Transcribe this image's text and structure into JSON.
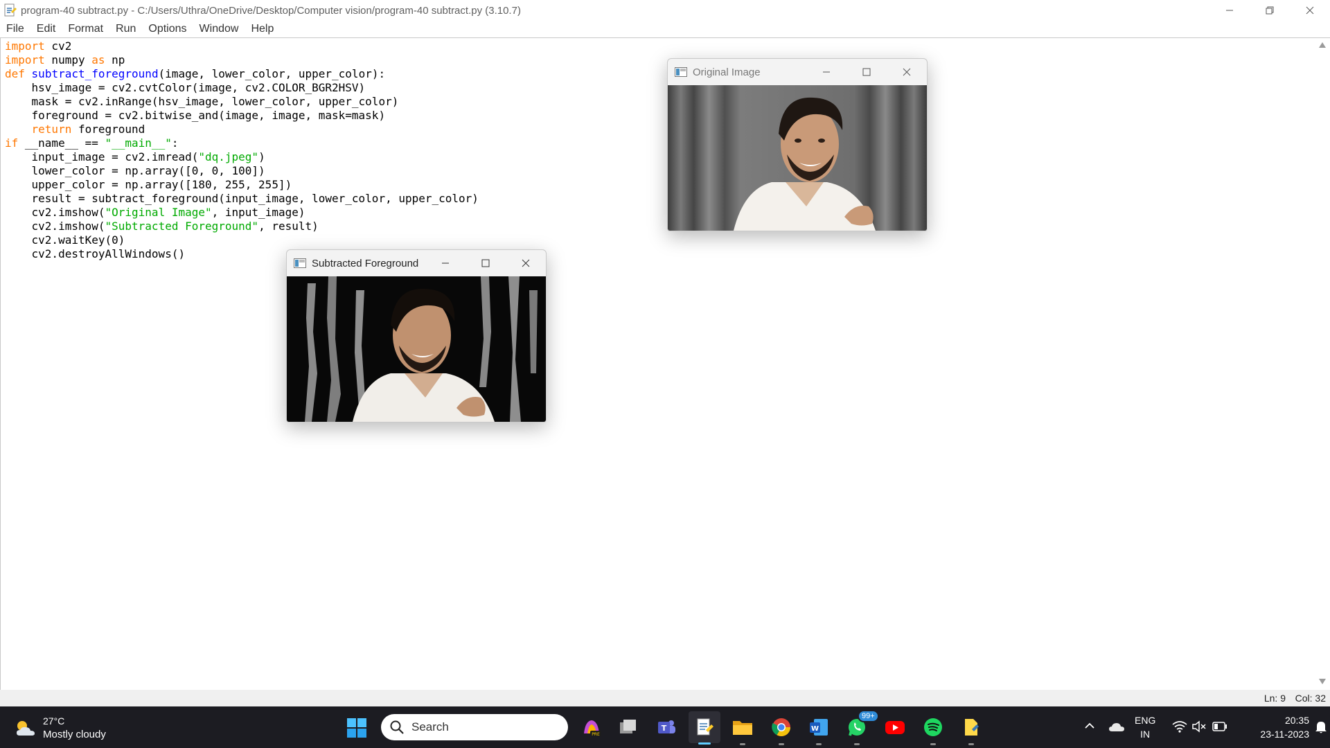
{
  "titlebar": {
    "title": "program-40 subtract.py - C:/Users/Uthra/OneDrive/Desktop/Computer vision/program-40 subtract.py (3.10.7)",
    "icon": "python-file-icon"
  },
  "menu": [
    "File",
    "Edit",
    "Format",
    "Run",
    "Options",
    "Window",
    "Help"
  ],
  "editor": {
    "lines": [
      [
        {
          "t": "import",
          "c": "kw"
        },
        {
          "t": " cv2"
        }
      ],
      [
        {
          "t": "import",
          "c": "kw"
        },
        {
          "t": " numpy "
        },
        {
          "t": "as",
          "c": "kw"
        },
        {
          "t": " np"
        }
      ],
      [
        {
          "t": "def",
          "c": "kw"
        },
        {
          "t": " "
        },
        {
          "t": "subtract_foreground",
          "c": "fn"
        },
        {
          "t": "(image, lower_color, upper_color):"
        }
      ],
      [
        {
          "t": "    hsv_image = cv2.cvtColor(image, cv2.COLOR_BGR2HSV)"
        }
      ],
      [
        {
          "t": "    mask = cv2.inRange(hsv_image, lower_color, upper_color)"
        }
      ],
      [
        {
          "t": "    foreground = cv2.bitwise_and(image, image, mask=mask)"
        }
      ],
      [
        {
          "t": "    "
        },
        {
          "t": "return",
          "c": "kw"
        },
        {
          "t": " foreground"
        }
      ],
      [
        {
          "t": "if",
          "c": "kw"
        },
        {
          "t": " __name__ == "
        },
        {
          "t": "\"__main__\"",
          "c": "str"
        },
        {
          "t": ":"
        }
      ],
      [
        {
          "t": "    input_image = cv2.imread("
        },
        {
          "t": "\"dq.jpeg\"",
          "c": "str"
        },
        {
          "t": ")"
        }
      ],
      [
        {
          "t": "    lower_color = np.array([0, 0, 100])"
        }
      ],
      [
        {
          "t": "    upper_color = np.array([180, 255, 255])"
        }
      ],
      [
        {
          "t": "    result = subtract_foreground(input_image, lower_color, upper_color)"
        }
      ],
      [
        {
          "t": "    cv2.imshow("
        },
        {
          "t": "\"Original Image\"",
          "c": "str"
        },
        {
          "t": ", input_image)"
        }
      ],
      [
        {
          "t": "    cv2.imshow("
        },
        {
          "t": "\"Subtracted Foreground\"",
          "c": "str"
        },
        {
          "t": ", result)"
        }
      ],
      [
        {
          "t": "    cv2.waitKey(0)"
        }
      ],
      [
        {
          "t": "    cv2.destroyAllWindows()"
        }
      ]
    ]
  },
  "status": {
    "ln": "Ln: 9",
    "col": "Col: 32"
  },
  "windows": {
    "original": {
      "title": "Original Image"
    },
    "subtracted": {
      "title": "Subtracted Foreground"
    }
  },
  "taskbar": {
    "weather": {
      "temp": "27°C",
      "condition": "Mostly cloudy",
      "icon": "partly-cloudy-icon"
    },
    "search_label": "Search",
    "apps": [
      {
        "name": "copilot-pre-icon"
      },
      {
        "name": "task-view-icon"
      },
      {
        "name": "teams-icon"
      },
      {
        "name": "idle-python-icon",
        "active": true
      },
      {
        "name": "file-explorer-icon"
      },
      {
        "name": "chrome-icon"
      },
      {
        "name": "word-icon"
      },
      {
        "name": "whatsapp-icon",
        "badge": "99+"
      },
      {
        "name": "youtube-icon"
      },
      {
        "name": "spotify-icon"
      },
      {
        "name": "python-file-icon"
      }
    ],
    "tray": {
      "lang1": "ENG",
      "lang2": "IN",
      "time": "20:35",
      "date": "23-11-2023"
    }
  },
  "colors": {
    "keyword": "#ff7700",
    "definition": "#0000ff",
    "string": "#00aa00",
    "taskbar": "#1c1c22",
    "accent": "#60cdff"
  }
}
